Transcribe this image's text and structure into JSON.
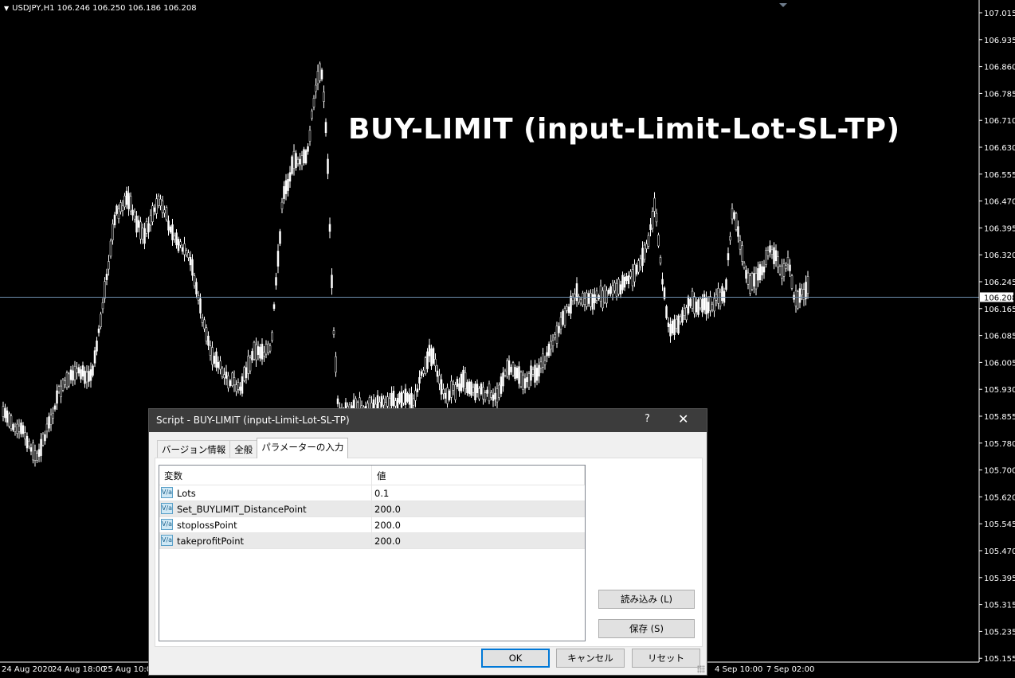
{
  "chart": {
    "symbol_info": "USDJPY,H1  106.246 106.250 106.186 106.208",
    "overlay_title": "BUY-LIMIT (input-Limit-Lot-SL-TP)",
    "current_price": "106.208",
    "current_price_value": 106.208,
    "price_min": 105.15,
    "price_max": 107.04,
    "price_labels": [
      "107.015",
      "106.935",
      "106.860",
      "106.785",
      "106.710",
      "106.630",
      "106.555",
      "106.470",
      "106.395",
      "106.320",
      "106.245",
      "106.165",
      "106.085",
      "106.005",
      "105.930",
      "105.855",
      "105.780",
      "105.700",
      "105.620",
      "105.545",
      "105.470",
      "105.395",
      "105.315",
      "105.235",
      "105.155"
    ],
    "time_labels": [
      "24 Aug 2020",
      "24 Aug 18:00",
      "25 Aug 10:00",
      "4 Sep 10:00",
      "7 Sep 02:00"
    ],
    "colors": {
      "background": "#000000",
      "candle": "#ffffff",
      "price_line": "#6f8fb0",
      "axis": "#ffffff"
    }
  },
  "dialog": {
    "title": "Script - BUY-LIMIT (input-Limit-Lot-SL-TP)",
    "help_label": "?",
    "close_label": "✕",
    "tabs": [
      {
        "label": "バージョン情報"
      },
      {
        "label": "全般"
      },
      {
        "label": "パラメーターの入力"
      }
    ],
    "table": {
      "col_variable": "変数",
      "col_value": "値",
      "rows": [
        {
          "icon": "V/a",
          "name": "Lots",
          "value": "0.1"
        },
        {
          "icon": "V/a",
          "name": "Set_BUYLIMIT_DistancePoint",
          "value": "200.0"
        },
        {
          "icon": "V/a",
          "name": "stoplossPoint",
          "value": "200.0"
        },
        {
          "icon": "V/a",
          "name": "takeprofitPoint",
          "value": "200.0"
        }
      ]
    },
    "buttons": {
      "load": "読み込み (L)",
      "save": "保存 (S)",
      "ok": "OK",
      "cancel": "キャンセル",
      "reset": "リセット"
    }
  }
}
